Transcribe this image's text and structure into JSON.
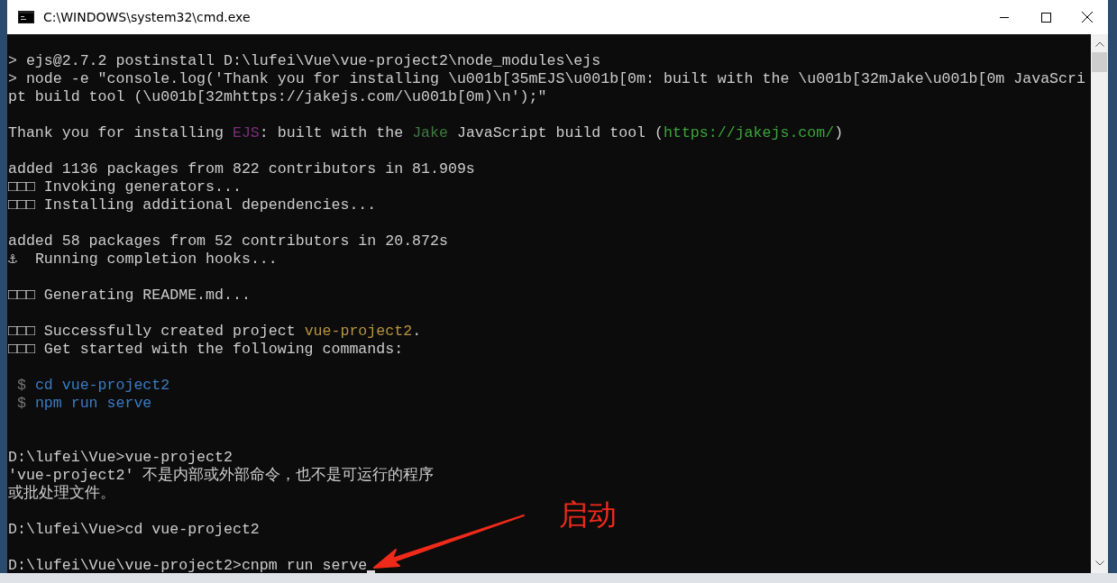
{
  "window": {
    "title": "C:\\WINDOWS\\system32\\cmd.exe"
  },
  "console": {
    "lines": [
      {
        "kind": "text",
        "segments": [
          {
            "text": "> ejs@2.7.2 postinstall D:\\lufei\\Vue\\vue-project2\\node_modules\\ejs"
          }
        ]
      },
      {
        "kind": "text",
        "segments": [
          {
            "text": "> node -e \"console.log('Thank you for installing \\u001b[35mEJS\\u001b[0m: built with the \\u001b[32mJake\\u001b[0m JavaScri"
          }
        ]
      },
      {
        "kind": "text",
        "segments": [
          {
            "text": "pt build tool (\\u001b[32mhttps://jakejs.com/\\u001b[0m)\\n');\""
          }
        ]
      },
      {
        "kind": "blank"
      },
      {
        "kind": "text",
        "segments": [
          {
            "text": "Thank you for installing "
          },
          {
            "text": "EJS",
            "color": "#7a2f7a"
          },
          {
            "text": ": built with the "
          },
          {
            "text": "Jake",
            "color": "#3f7a3f"
          },
          {
            "text": " JavaScript build tool ("
          },
          {
            "text": "https://jakejs.com/",
            "color": "#3aa53a"
          },
          {
            "text": ")"
          }
        ]
      },
      {
        "kind": "blank"
      },
      {
        "kind": "text",
        "segments": [
          {
            "text": "added 1136 packages from 822 contributors in 81.909s"
          }
        ]
      },
      {
        "kind": "text",
        "segments": [
          {
            "text": "□□□ Invoking generators..."
          }
        ]
      },
      {
        "kind": "text",
        "segments": [
          {
            "text": "□□□ Installing additional dependencies..."
          }
        ]
      },
      {
        "kind": "blank"
      },
      {
        "kind": "text",
        "segments": [
          {
            "text": "added 58 packages from 52 contributors in 20.872s"
          }
        ]
      },
      {
        "kind": "text",
        "segments": [
          {
            "text": "⚓  Running completion hooks..."
          }
        ]
      },
      {
        "kind": "blank"
      },
      {
        "kind": "text",
        "segments": [
          {
            "text": "□□□ Generating README.md..."
          }
        ]
      },
      {
        "kind": "blank"
      },
      {
        "kind": "text",
        "segments": [
          {
            "text": "□□□ Successfully created project "
          },
          {
            "text": "vue-project2",
            "color": "#b8943f"
          },
          {
            "text": "."
          }
        ]
      },
      {
        "kind": "text",
        "segments": [
          {
            "text": "□□□ Get started with the following commands:"
          }
        ]
      },
      {
        "kind": "blank"
      },
      {
        "kind": "text",
        "segments": [
          {
            "text": " $ ",
            "color": "#777777"
          },
          {
            "text": "cd vue-project2",
            "color": "#3b7cc4"
          }
        ]
      },
      {
        "kind": "text",
        "segments": [
          {
            "text": " $ ",
            "color": "#777777"
          },
          {
            "text": "npm run serve",
            "color": "#3b7cc4"
          }
        ]
      },
      {
        "kind": "blank"
      },
      {
        "kind": "blank"
      },
      {
        "kind": "text",
        "segments": [
          {
            "text": "D:\\lufei\\Vue>vue-project2"
          }
        ]
      },
      {
        "kind": "text",
        "segments": [
          {
            "text": "'vue-project2' 不是内部或外部命令，也不是可运行的程序"
          }
        ]
      },
      {
        "kind": "text",
        "segments": [
          {
            "text": "或批处理文件。"
          }
        ]
      },
      {
        "kind": "blank"
      },
      {
        "kind": "text",
        "segments": [
          {
            "text": "D:\\lufei\\Vue>cd vue-project2"
          }
        ]
      },
      {
        "kind": "blank"
      },
      {
        "kind": "prompt",
        "segments": [
          {
            "text": "D:\\lufei\\Vue\\vue-project2>cnpm run serve"
          }
        ]
      }
    ]
  },
  "annotation": {
    "label": "启动"
  }
}
